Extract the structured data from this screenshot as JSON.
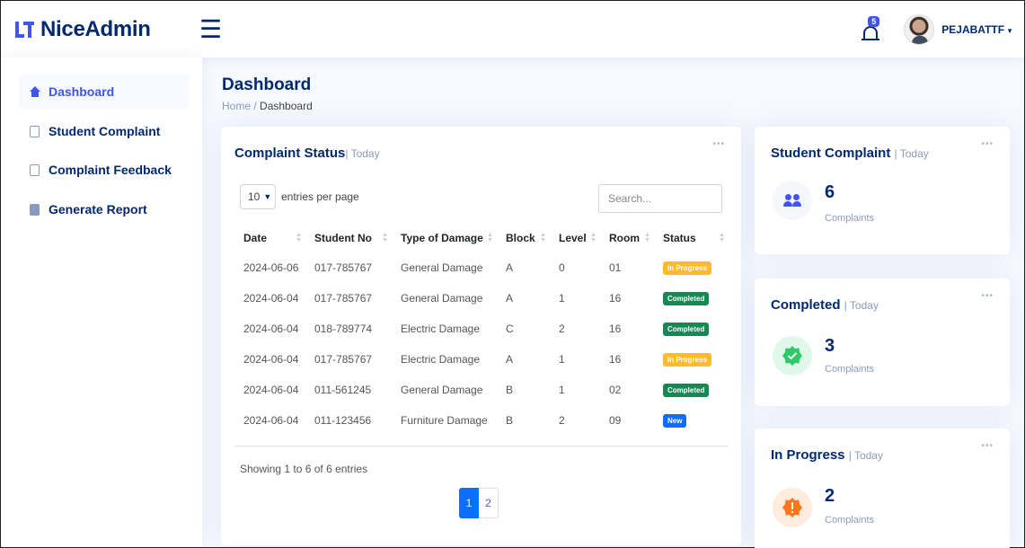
{
  "app": {
    "name": "NiceAdmin"
  },
  "header": {
    "notifications_count": "5",
    "username": "PEJABATTF"
  },
  "sidebar": {
    "items": [
      {
        "label": "Dashboard",
        "icon": "home-icon",
        "active": true
      },
      {
        "label": "Student Complaint",
        "icon": "document-icon",
        "active": false
      },
      {
        "label": "Complaint Feedback",
        "icon": "document-icon",
        "active": false
      },
      {
        "label": "Generate Report",
        "icon": "report-icon",
        "active": false
      }
    ]
  },
  "page": {
    "title": "Dashboard",
    "breadcrumb": {
      "home": "Home",
      "separator": "/",
      "current": "Dashboard"
    }
  },
  "complaint_status": {
    "title": "Complaint Status",
    "subtitle": "| Today",
    "entries_value": "10",
    "entries_label": "entries per page",
    "search_placeholder": "Search...",
    "columns": [
      "Date",
      "Student No",
      "Type of Damage",
      "Block",
      "Level",
      "Room",
      "Status"
    ],
    "rows": [
      {
        "date": "2024-06-06",
        "student_no": "017-785767",
        "type": "General Damage",
        "block": "A",
        "level": "0",
        "room": "01",
        "status": "In Progress",
        "status_class": "in-progress"
      },
      {
        "date": "2024-06-04",
        "student_no": "017-785767",
        "type": "General Damage",
        "block": "A",
        "level": "1",
        "room": "16",
        "status": "Completed",
        "status_class": "completed"
      },
      {
        "date": "2024-06-04",
        "student_no": "018-789774",
        "type": "Electric Damage",
        "block": "C",
        "level": "2",
        "room": "16",
        "status": "Completed",
        "status_class": "completed"
      },
      {
        "date": "2024-06-04",
        "student_no": "017-785767",
        "type": "Electric Damage",
        "block": "A",
        "level": "1",
        "room": "16",
        "status": "In Progress",
        "status_class": "in-progress"
      },
      {
        "date": "2024-06-04",
        "student_no": "011-561245",
        "type": "General Damage",
        "block": "B",
        "level": "1",
        "room": "02",
        "status": "Completed",
        "status_class": "completed"
      },
      {
        "date": "2024-06-04",
        "student_no": "011-123456",
        "type": "Furniture Damage",
        "block": "B",
        "level": "2",
        "room": "09",
        "status": "New",
        "status_class": "new"
      }
    ],
    "showing_text": "Showing 1 to 6 of 6 entries",
    "pages": [
      "1",
      "2"
    ],
    "active_page": "1"
  },
  "stats": [
    {
      "title": "Student Complaint",
      "subtitle": "| Today",
      "value": "6",
      "label": "Complaints",
      "icon": "people-icon",
      "bg": "#f6f6fe",
      "color": "#4154f1"
    },
    {
      "title": "Completed",
      "subtitle": "| Today",
      "value": "3",
      "label": "Complaints",
      "icon": "check-badge-icon",
      "bg": "#e0f8e9",
      "color": "#2eca6a"
    },
    {
      "title": "In Progress",
      "subtitle": "| Today",
      "value": "2",
      "label": "Complaints",
      "icon": "alert-badge-icon",
      "bg": "#ffecdf",
      "color": "#ff771d"
    }
  ],
  "card_menu_icon": "more-dots-icon"
}
